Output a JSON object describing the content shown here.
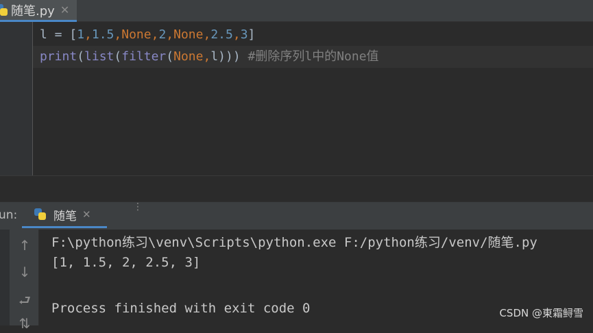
{
  "editor": {
    "tab": {
      "label": "随笔.py",
      "close": "✕"
    },
    "lines": [
      {
        "tokens": [
          {
            "text": "l = [",
            "cls": ""
          },
          {
            "text": "1",
            "cls": "num"
          },
          {
            "text": ",",
            "cls": "kw"
          },
          {
            "text": "1.5",
            "cls": "num"
          },
          {
            "text": ",",
            "cls": "kw"
          },
          {
            "text": "None",
            "cls": "kw"
          },
          {
            "text": ",",
            "cls": "kw"
          },
          {
            "text": "2",
            "cls": "num"
          },
          {
            "text": ",",
            "cls": "kw"
          },
          {
            "text": "None",
            "cls": "kw"
          },
          {
            "text": ",",
            "cls": "kw"
          },
          {
            "text": "2.5",
            "cls": "num"
          },
          {
            "text": ",",
            "cls": "kw"
          },
          {
            "text": "3",
            "cls": "num"
          },
          {
            "text": "]",
            "cls": ""
          }
        ]
      },
      {
        "tokens": [
          {
            "text": "print",
            "cls": "fn"
          },
          {
            "text": "(",
            "cls": ""
          },
          {
            "text": "list",
            "cls": "fn"
          },
          {
            "text": "(",
            "cls": ""
          },
          {
            "text": "filter",
            "cls": "fn"
          },
          {
            "text": "(",
            "cls": ""
          },
          {
            "text": "None",
            "cls": "kw"
          },
          {
            "text": ",",
            "cls": "kw"
          },
          {
            "text": "l",
            "cls": ""
          },
          {
            "text": "))) ",
            "cls": ""
          },
          {
            "text": "#删除序列l中的None值",
            "cls": "cm"
          }
        ]
      }
    ]
  },
  "run": {
    "label": "un:",
    "tab_label": "随笔",
    "tab_close": "✕",
    "options": "⋮",
    "toolbar": {
      "up": "↑",
      "down": "↓",
      "wrap": "⮐",
      "sort": "⇅"
    },
    "console": [
      "F:\\python练习\\venv\\Scripts\\python.exe F:/python练习/venv/随笔.py",
      "[1, 1.5, 2, 2.5, 3]",
      "",
      "Process finished with exit code 0"
    ]
  },
  "watermark": "CSDN @東霜鲟雪",
  "colors": {
    "background": "#2b2b2b",
    "number": "#6897bb",
    "keyword": "#cc7832",
    "builtin": "#8888c6",
    "comment": "#808080",
    "text": "#a9b7c6",
    "accent": "#4a88c7"
  }
}
